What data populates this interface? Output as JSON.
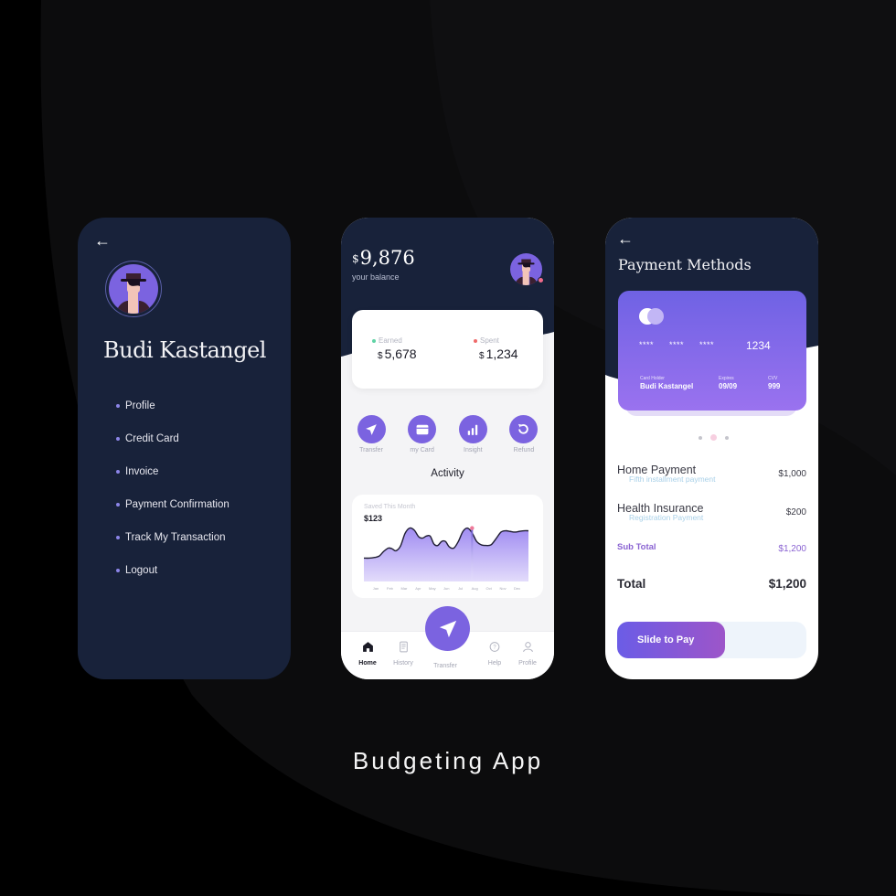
{
  "colors": {
    "navy": "#18223a",
    "accent": "#7b63e0",
    "earned_dot": "#5fd3a5",
    "spent_dot": "#ef6a6a",
    "subtotal": "#8a63d2",
    "background": "#0c0c0d"
  },
  "icons": {
    "back": "←"
  },
  "menu_screen": {
    "user_name": "Budi Kastangel",
    "items": [
      {
        "label": "Profile"
      },
      {
        "label": "Credit Card"
      },
      {
        "label": "Invoice"
      },
      {
        "label": "Payment Confirmation"
      },
      {
        "label": "Track My Transaction"
      },
      {
        "label": "Logout"
      }
    ]
  },
  "home_screen": {
    "balance_currency": "$",
    "balance": "9,876",
    "balance_label": "your balance",
    "earned": {
      "label": "Earned",
      "currency": "$",
      "value": "5,678"
    },
    "spent": {
      "label": "Spent",
      "currency": "$",
      "value": "1,234"
    },
    "actions": [
      {
        "label": "Transfer",
        "icon": "send-icon"
      },
      {
        "label": "my Card",
        "icon": "card-icon"
      },
      {
        "label": "Insight",
        "icon": "bar-chart-icon"
      },
      {
        "label": "Refund",
        "icon": "refund-icon"
      }
    ],
    "activity_title": "Activity",
    "nav": [
      {
        "label": "Home",
        "icon": "home-icon",
        "active": true
      },
      {
        "label": "History",
        "icon": "history-icon",
        "active": false
      },
      {
        "label": "Transfer",
        "icon": "send-icon",
        "active": false
      },
      {
        "label": "Help",
        "icon": "help-icon",
        "active": false
      },
      {
        "label": "Profile",
        "icon": "profile-icon",
        "active": false
      }
    ]
  },
  "chart_data": {
    "type": "area",
    "title": "Saved This Month",
    "value_label": "$123",
    "categories": [
      "Jan",
      "Feb",
      "Mar",
      "Apr",
      "May",
      "Jun",
      "Jul",
      "Aug",
      "Oct",
      "Nov",
      "Dec"
    ],
    "x": [
      0,
      0.35,
      0.7,
      1.0,
      1.3,
      1.6,
      1.85,
      2.1,
      2.4,
      2.7,
      3.0,
      3.3,
      3.6,
      3.85,
      4.1,
      4.35,
      4.6,
      4.85,
      5.1,
      5.35,
      5.6,
      5.9,
      6.2,
      6.5,
      6.8,
      7.1,
      7.4,
      7.7,
      8.0,
      8.35,
      8.7,
      9.0,
      9.3,
      9.6,
      9.9,
      10.2,
      10.5,
      10.8
    ],
    "values": [
      35,
      35,
      36,
      38,
      45,
      50,
      49,
      46,
      53,
      72,
      80,
      77,
      67,
      65,
      68,
      68,
      56,
      54,
      60,
      60,
      52,
      50,
      60,
      75,
      80,
      73,
      60,
      55,
      54,
      55,
      65,
      74,
      76,
      75,
      74,
      75,
      76,
      76
    ],
    "highlight": {
      "category": "Oct",
      "x": 7.1,
      "value": 80
    },
    "ylim": [
      0,
      100
    ],
    "grid": false,
    "legend": "none"
  },
  "payment_screen": {
    "title": "Payment Methods",
    "card": {
      "masked": [
        "****",
        "****",
        "****"
      ],
      "last4": "1234",
      "holder_label": "Card Holder",
      "holder": "Budi Kastangel",
      "expires_label": "Expires",
      "expires": "09/09",
      "cvv_label": "CVV",
      "cvv": "999"
    },
    "pager": {
      "count": 3,
      "active": 1
    },
    "items": [
      {
        "title": "Home Payment",
        "subtitle": "Fifth installment payment",
        "amount": "$1,000"
      },
      {
        "title": "Health Insurance",
        "subtitle": "Registration Payment",
        "amount": "$200"
      }
    ],
    "subtotal_label": "Sub Total",
    "subtotal": "$1,200",
    "total_label": "Total",
    "total": "$1,200",
    "slide_label": "Slide to Pay"
  },
  "caption": "Budgeting App"
}
